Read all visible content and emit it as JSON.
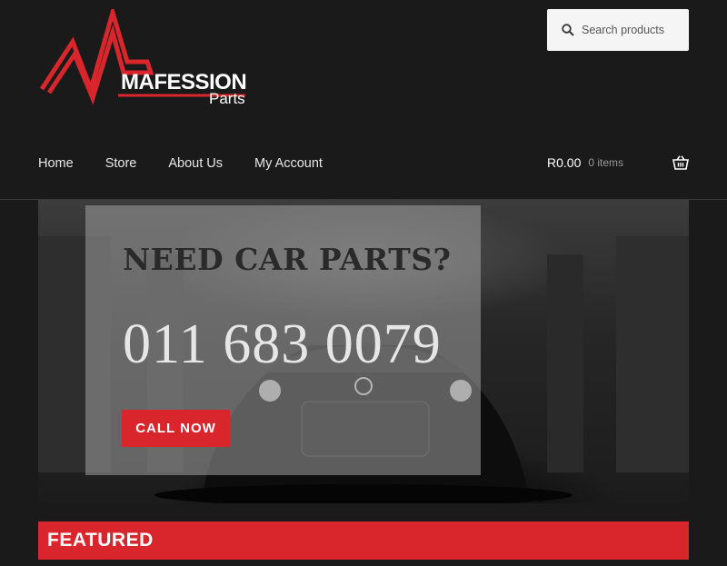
{
  "brand": {
    "name": "MAFESSION",
    "sub": "Parts",
    "accent": "#d9262d"
  },
  "search": {
    "placeholder": "Search products",
    "icon": "search-icon"
  },
  "nav": {
    "items": [
      {
        "label": "Home"
      },
      {
        "label": "Store"
      },
      {
        "label": "About Us"
      },
      {
        "label": "My Account"
      }
    ]
  },
  "cart": {
    "total": "R0.00",
    "count": "0 items",
    "icon": "basket-icon"
  },
  "hero": {
    "title": "NEED CAR PARTS?",
    "phone": "011 683 0079",
    "cta": "CALL NOW"
  },
  "featured": {
    "heading": "FEATURED"
  }
}
